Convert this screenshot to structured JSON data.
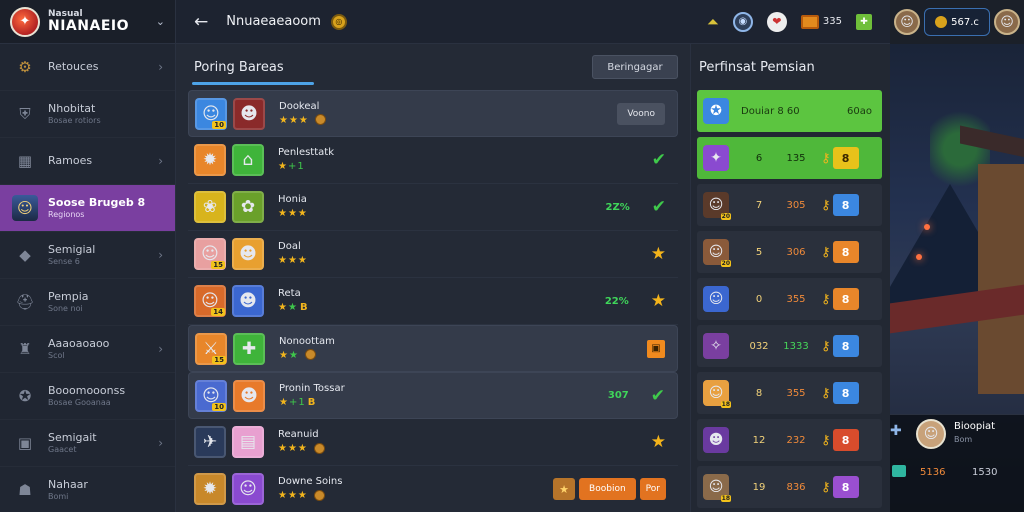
{
  "brand": {
    "line1": "Nasual",
    "line2": "NIANAEIO",
    "line3": "",
    "chevron": "⌄",
    "logo_glyph": "✦"
  },
  "sidebar": {
    "items": [
      {
        "label": "Retouces",
        "sub": "",
        "icon": "gear-icon",
        "glyph": "⚙",
        "arrow": "›"
      },
      {
        "label": "Nhobitat",
        "sub": "Bosae rotiors",
        "icon": "shield-icon",
        "glyph": "⛨",
        "arrow": ""
      },
      {
        "label": "Ramoes",
        "sub": "",
        "icon": "grid-icon",
        "glyph": "▦",
        "arrow": "›"
      },
      {
        "label": "Soose Brugeb 8",
        "sub": "Regionos",
        "icon": "hero-avatar-icon",
        "glyph": "☺",
        "arrow": ""
      },
      {
        "label": "Semigial",
        "sub": "Sense 6",
        "icon": "gem-icon",
        "glyph": "◆",
        "arrow": "›"
      },
      {
        "label": "Pempia",
        "sub": "Sone noi",
        "icon": "helmet-icon",
        "glyph": "⛑",
        "arrow": ""
      },
      {
        "label": "Aaaoaoaoo",
        "sub": "Scol",
        "icon": "trophy-icon",
        "glyph": "♜",
        "arrow": "›"
      },
      {
        "label": "Booomooonss",
        "sub": "Bosae Gooanaa",
        "icon": "badge-icon",
        "glyph": "✪",
        "arrow": ""
      },
      {
        "label": "Semigait",
        "sub": "Gaacet",
        "icon": "crate-icon",
        "glyph": "▣",
        "arrow": "›"
      },
      {
        "label": "Nahaar",
        "sub": "Bomi",
        "icon": "chest-icon",
        "glyph": "☗",
        "arrow": ""
      }
    ]
  },
  "topbar": {
    "back": "←",
    "title": "Nnuaeaeaoom",
    "icons": [
      {
        "name": "rank-icon",
        "glyph": "⏶",
        "value": ""
      },
      {
        "name": "badge-icon",
        "glyph": "◉",
        "value": ""
      },
      {
        "name": "gift-icon",
        "glyph": "❤",
        "value": ""
      },
      {
        "name": "chest-icon",
        "glyph": "",
        "value": "335"
      },
      {
        "name": "leaf-icon",
        "glyph": "✚",
        "value": ""
      }
    ]
  },
  "profile": {
    "coins": "567.c",
    "avatar_glyph": "☺",
    "avatar2_glyph": "☺"
  },
  "main": {
    "title": "Poring Bareas",
    "sort_label": "Beringagar",
    "rows": [
      {
        "name": "Dookeal",
        "stars": "★★★",
        "green": "",
        "extra": "",
        "coin": true,
        "av1": "☺",
        "av1c": "#3b87e0",
        "av2": "☻",
        "av2c": "#8a2a2a",
        "lv1": "10",
        "lv2": "",
        "pct": "",
        "right": "lock",
        "right_label": "Voono",
        "hl": true
      },
      {
        "name": "Penlesttatk",
        "stars": "★",
        "green": "+1",
        "extra": "",
        "coin": false,
        "av1": "✹",
        "av1c": "#e8862a",
        "av2": "⌂",
        "av2c": "#3fb43a",
        "lv1": "",
        "lv2": "",
        "pct": "",
        "right": "check",
        "right_label": "",
        "hl": false
      },
      {
        "name": "Honia",
        "stars": "★★★",
        "green": "",
        "extra": "",
        "coin": false,
        "av1": "❀",
        "av1c": "#d8b41c",
        "av2": "✿",
        "av2c": "#6aa02a",
        "lv1": "",
        "lv2": "",
        "pct": "2Z%",
        "right": "check",
        "right_label": "",
        "hl": false
      },
      {
        "name": "Doal",
        "stars": "★★★",
        "green": "",
        "extra": "",
        "coin": false,
        "av1": "☺",
        "av1c": "#e8a0a0",
        "av2": "☻",
        "av2c": "#e8a030",
        "lv1": "15",
        "lv2": "",
        "pct": "",
        "right": "star",
        "right_label": "",
        "hl": false
      },
      {
        "name": "Reta",
        "stars": "★",
        "green": "★",
        "extra": "B",
        "coin": false,
        "av1": "☺",
        "av1c": "#d86a2a",
        "av2": "☻",
        "av2c": "#3b67d0",
        "lv1": "14",
        "lv2": "",
        "pct": "22%",
        "right": "star",
        "right_label": "",
        "hl": false
      },
      {
        "name": "Nonoottam",
        "stars": "★",
        "green": "★",
        "extra": "",
        "coin": true,
        "av1": "⚔",
        "av1c": "#e8862a",
        "av2": "✚",
        "av2c": "#3fb43a",
        "lv1": "15",
        "lv2": "",
        "pct": "",
        "right": "obox",
        "right_label": "",
        "hl": true
      },
      {
        "name": "Pronin Tossar",
        "stars": "★",
        "green": "+1",
        "extra": "B",
        "coin": false,
        "av1": "☺",
        "av1c": "#4a6ad0",
        "av2": "☻",
        "av2c": "#e87a2a",
        "lv1": "10",
        "lv2": "",
        "pct": "307",
        "right": "check",
        "right_label": "",
        "hl": true
      },
      {
        "name": "Reanuid",
        "stars": "★★★",
        "green": "",
        "extra": "",
        "coin": true,
        "av1": "✈",
        "av1c": "#2a3a5a",
        "av2": "▤",
        "av2c": "#e8a0d0",
        "lv1": "",
        "lv2": "",
        "pct": "",
        "right": "star",
        "right_label": "",
        "hl": false
      },
      {
        "name": "Downe Soins",
        "stars": "★★★",
        "green": "",
        "extra": "",
        "coin": true,
        "av1": "✹",
        "av1c": "#c8882a",
        "av2": "☺",
        "av2c": "#8a4ad0",
        "lv1": "",
        "lv2": "",
        "pct": "",
        "right": "buttons",
        "right_label": "Boobion",
        "right_label2": "Por",
        "hl": false
      }
    ]
  },
  "rank": {
    "title": "Perfinsat Pemsian",
    "rows": [
      {
        "type": "first",
        "name": "Douiar 8 60",
        "value": "60ao",
        "glyph": "✪",
        "color": "#3b87e0"
      },
      {
        "type": "green2",
        "n": "6",
        "s": "135",
        "box": "8",
        "boxc": "gold",
        "glyph": "✦",
        "color": "#8a4ad0"
      },
      {
        "type": "n",
        "n": "7",
        "s": "305",
        "box": "8",
        "boxc": "blue",
        "glyph": "☺",
        "color": "#5a3a2a",
        "lv": "20"
      },
      {
        "type": "n",
        "n": "5",
        "s": "306",
        "box": "8",
        "boxc": "orange",
        "glyph": "☺",
        "color": "#8a5a3a",
        "lv": "20"
      },
      {
        "type": "n",
        "n": "0",
        "s": "355",
        "box": "8",
        "boxc": "orange",
        "glyph": "☺",
        "color": "#3b67d0",
        "lv": ""
      },
      {
        "type": "n",
        "n": "032",
        "s": "1333",
        "box": "8",
        "boxc": "blue",
        "glyph": "✧",
        "color": "#7a3fa0",
        "lv": "",
        "green": true
      },
      {
        "type": "n",
        "n": "8",
        "s": "355",
        "box": "8",
        "boxc": "blue",
        "glyph": "☺",
        "color": "#e8a040",
        "lv": "18"
      },
      {
        "type": "n",
        "n": "12",
        "s": "232",
        "box": "8",
        "boxc": "red",
        "glyph": "☻",
        "color": "#6a3aa0",
        "lv": ""
      },
      {
        "type": "n",
        "n": "19",
        "s": "836",
        "box": "8",
        "boxc": "purple",
        "glyph": "☺",
        "color": "#8a6a4a",
        "lv": "18"
      }
    ]
  },
  "npc": {
    "name": "Bioopiat",
    "sub": "Bom",
    "v1": "5136",
    "v2": "1530",
    "avatar_glyph": "☺"
  }
}
